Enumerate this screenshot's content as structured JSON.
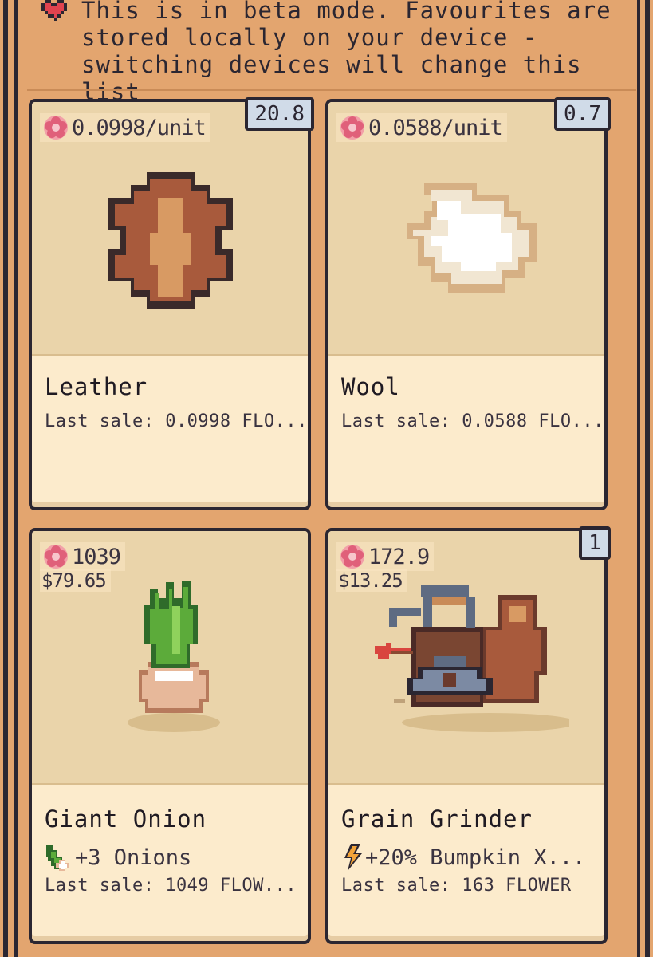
{
  "notice": {
    "icon": "heart-icon",
    "text": "This is in beta mode. Favourites are\nstored locally on your device -\nswitching devices will change this list"
  },
  "colors": {
    "background": "#e3a56f",
    "card": "#fcebcc",
    "image_area": "#ead4aa",
    "border": "#2b2631",
    "badge": "#d0dbe8"
  },
  "cards": [
    {
      "name": "Leather",
      "price": "0.0998/unit",
      "badge": "20.8",
      "last_sale": "Last sale: 0.0998 FLO...",
      "icon": "leather-icon"
    },
    {
      "name": "Wool",
      "price": "0.0588/unit",
      "badge": "0.7",
      "last_sale": "Last sale: 0.0588 FLO...",
      "icon": "wool-icon"
    },
    {
      "name": "Giant Onion",
      "price": "1039",
      "usd": "$79.65",
      "boost": "+3 Onions",
      "boost_icon": "onion-icon",
      "last_sale": "Last sale: 1049 FLOW...",
      "icon": "giant-onion-icon"
    },
    {
      "name": "Grain Grinder",
      "price": "172.9",
      "usd": "$13.25",
      "badge": "1",
      "boost": "+20% Bumpkin X...",
      "boost_icon": "lightning-icon",
      "last_sale": "Last sale: 163 FLOWER",
      "icon": "grain-grinder-icon"
    }
  ]
}
